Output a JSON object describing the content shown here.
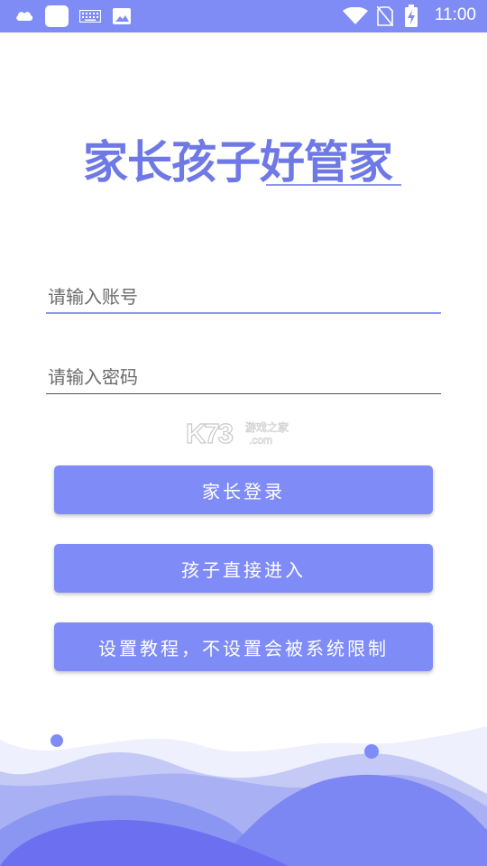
{
  "status_bar": {
    "time": "11:00",
    "icons": [
      "cloud-icon",
      "app-icon",
      "keyboard-icon",
      "image-icon",
      "wifi-icon",
      "no-sim-icon",
      "battery-charging-icon"
    ]
  },
  "logo": {
    "title": "家长孩子好管家"
  },
  "form": {
    "account_placeholder": "请输入账号",
    "password_placeholder": "请输入密码"
  },
  "watermark": {
    "brand": "K73",
    "cn": "游戏之家",
    "domain": ".com"
  },
  "buttons": {
    "parent_login": "家长登录",
    "child_enter": "孩子直接进入",
    "tutorial": "设置教程，不设置会被系统限制"
  },
  "colors": {
    "accent": "#7f8cf7",
    "status_bar": "#7f8cf5",
    "logo": "#6f79e6",
    "active_underline": "#8e97ee",
    "inactive_underline": "#555555"
  }
}
